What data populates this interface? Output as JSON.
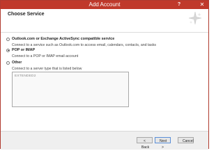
{
  "window": {
    "title": "Add Account",
    "help_glyph": "?",
    "close_glyph": "✕"
  },
  "header": {
    "title": "Choose Service"
  },
  "options": [
    {
      "label": "Outlook.com or Exchange ActiveSync compatible service",
      "description": "Connect to a service such as Outlook.com to access email, calendars, contacts, and tasks",
      "selected": false
    },
    {
      "label": "POP or IMAP",
      "description": "Connect to a POP or IMAP email account",
      "selected": true
    },
    {
      "label": "Other",
      "description": "Connect to a server type that is listed below",
      "selected": false
    }
  ],
  "other_list": {
    "items": [
      "EXTENDED2"
    ]
  },
  "buttons": {
    "back": "< Back",
    "next": "Next >",
    "cancel": "Cancel"
  },
  "colors": {
    "titlebar": "#c0392b",
    "accent": "#5a8fd8"
  },
  "icons": {
    "header": "sparkle-icon"
  }
}
